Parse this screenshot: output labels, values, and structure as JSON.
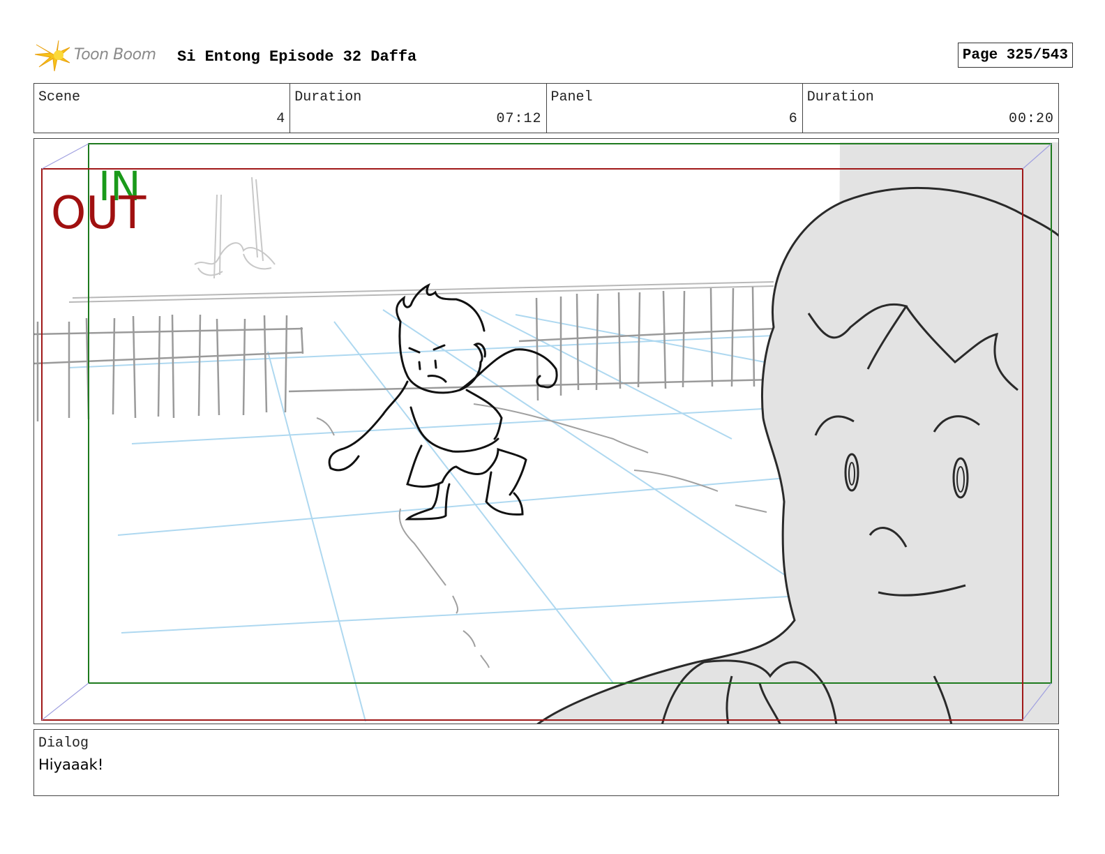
{
  "header": {
    "logo_text": "Toon Boom",
    "project_title": "Si Entong Episode 32 Daffa",
    "page_label": "Page 325/543"
  },
  "info": {
    "scene_label": "Scene",
    "scene_value": "4",
    "scene_duration_label": "Duration",
    "scene_duration_value": "07:12",
    "panel_label": "Panel",
    "panel_value": "6",
    "panel_duration_label": "Duration",
    "panel_duration_value": "00:20"
  },
  "panel": {
    "in_label": "IN",
    "out_label": "OUT",
    "in_color": "#1a9a1a",
    "out_color": "#a01010"
  },
  "dialog": {
    "label": "Dialog",
    "text": "Hiyaaak!"
  }
}
